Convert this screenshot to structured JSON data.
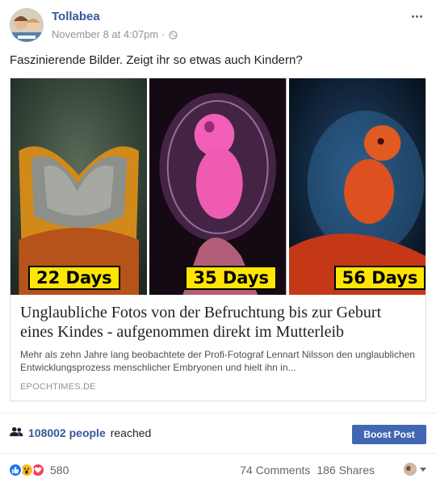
{
  "header": {
    "page_name": "Tollabea",
    "timestamp": "November 8 at 4:07pm",
    "separator": "·",
    "privacy_icon": "globe-icon",
    "menu_icon": "more-options-icon"
  },
  "post": {
    "text": "Faszinierende Bilder. Zeigt ihr so etwas auch Kindern?"
  },
  "link_card": {
    "panels": [
      {
        "label": "22 Days"
      },
      {
        "label": "35 Days"
      },
      {
        "label": "56 Days"
      }
    ],
    "title": "Unglaubliche Fotos von der Befruchtung bis zur Geburt eines Kindes - aufgenommen direkt im Mutterleib",
    "description": "Mehr als zehn Jahre lang beobachtete der Profi-Fotograf Lennart Nilsson den unglaublichen Entwicklungsprozess menschlicher Embryonen und hielt ihn in...",
    "domain": "EPOCHTIMES.DE"
  },
  "insights": {
    "reach_icon": "people-icon",
    "reach_count": "108002 people",
    "reach_text": "reached",
    "boost_label": "Boost Post"
  },
  "footer": {
    "reaction_icons": [
      "like-icon",
      "wow-icon",
      "love-icon"
    ],
    "reaction_count": "580",
    "comments": "74 Comments",
    "shares": "186 Shares"
  },
  "colors": {
    "link_blue": "#365899",
    "boost_blue": "#4267b2",
    "label_yellow": "#ffe600",
    "like_blue": "#1877f2",
    "wow_yellow": "#f7b928",
    "love_red": "#f33e58"
  }
}
